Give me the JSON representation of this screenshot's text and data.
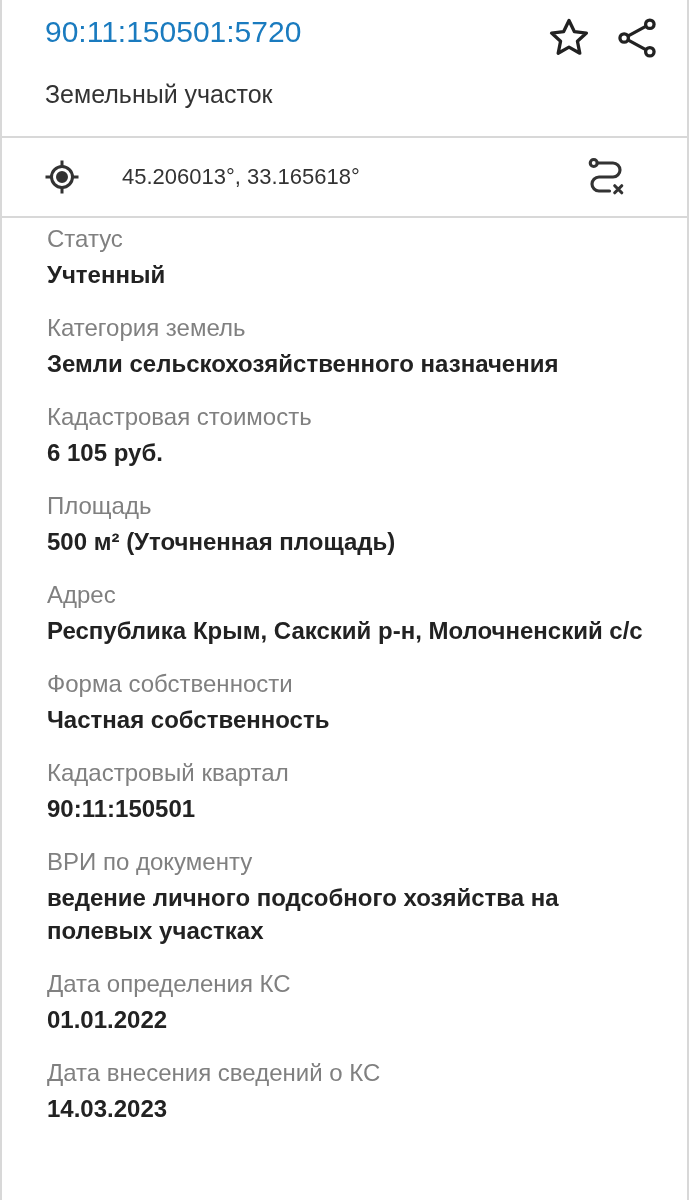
{
  "header": {
    "cadastral_number": "90:11:150501:5720",
    "subtitle": "Земельный участок"
  },
  "coordinates": {
    "text": "45.206013°, 33.165618°"
  },
  "fields": [
    {
      "label": "Статус",
      "value": "Учтенный"
    },
    {
      "label": "Категория земель",
      "value": "Земли сельскохозяйственного назначения"
    },
    {
      "label": "Кадастровая стоимость",
      "value": "6 105 руб."
    },
    {
      "label": "Площадь",
      "value": "500 м² (Уточненная площадь)"
    },
    {
      "label": "Адрес",
      "value": "Республика Крым, Сакский р-н, Молочненский с/с"
    },
    {
      "label": "Форма собственности",
      "value": "Частная собственность"
    },
    {
      "label": "Кадастровый квартал",
      "value": "90:11:150501"
    },
    {
      "label": "ВРИ по документу",
      "value": "ведение личного подсобного хозяйства на полевых участках"
    },
    {
      "label": "Дата определения КС",
      "value": "01.01.2022"
    },
    {
      "label": "Дата внесения сведений о КС",
      "value": "14.03.2023"
    }
  ]
}
